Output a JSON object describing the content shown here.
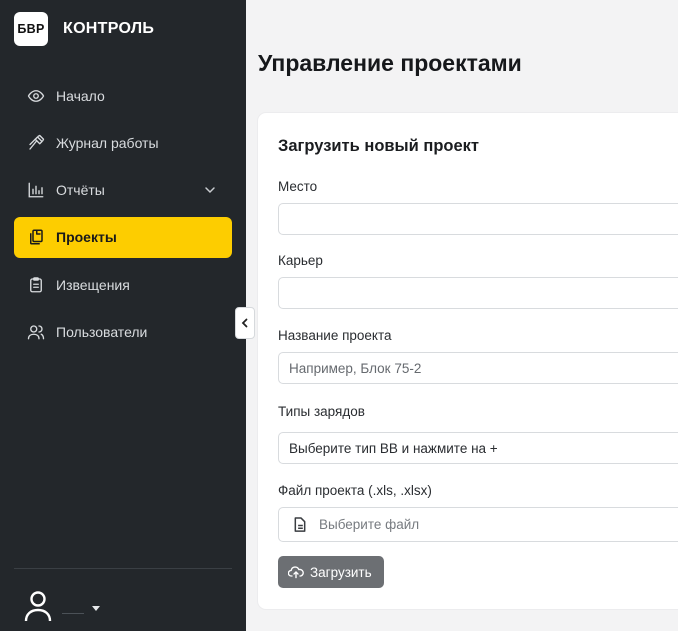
{
  "brand": {
    "logo_text": "БВР",
    "name": "КОНТРОЛЬ"
  },
  "sidebar": {
    "items": [
      {
        "label": "Начало",
        "icon": "eye-icon",
        "active": false
      },
      {
        "label": "Журнал работы",
        "icon": "hammer-icon",
        "active": false
      },
      {
        "label": "Отчёты",
        "icon": "bar-chart-icon",
        "active": false,
        "has_submenu": true
      },
      {
        "label": "Проекты",
        "icon": "documents-icon",
        "active": true
      },
      {
        "label": "Извещения",
        "icon": "clipboard-icon",
        "active": false
      },
      {
        "label": "Пользователи",
        "icon": "users-icon",
        "active": false
      }
    ],
    "accent_color": "#fdcd00",
    "background_color": "#23272b"
  },
  "page": {
    "title": "Управление проектами"
  },
  "form": {
    "title": "Загрузить новый проект",
    "fields": {
      "place": {
        "label": "Место",
        "value": ""
      },
      "quarry": {
        "label": "Карьер",
        "value": ""
      },
      "project_name": {
        "label": "Название проекта",
        "placeholder": "Например, Блок 75-2"
      },
      "charge_types": {
        "label": "Типы зарядов",
        "placeholder": "Выберите тип ВВ и нажмите на +"
      },
      "project_file": {
        "label": "Файл проекта (.xls, .xlsx)",
        "placeholder": "Выберите файл"
      }
    },
    "submit_label": "Загрузить"
  }
}
